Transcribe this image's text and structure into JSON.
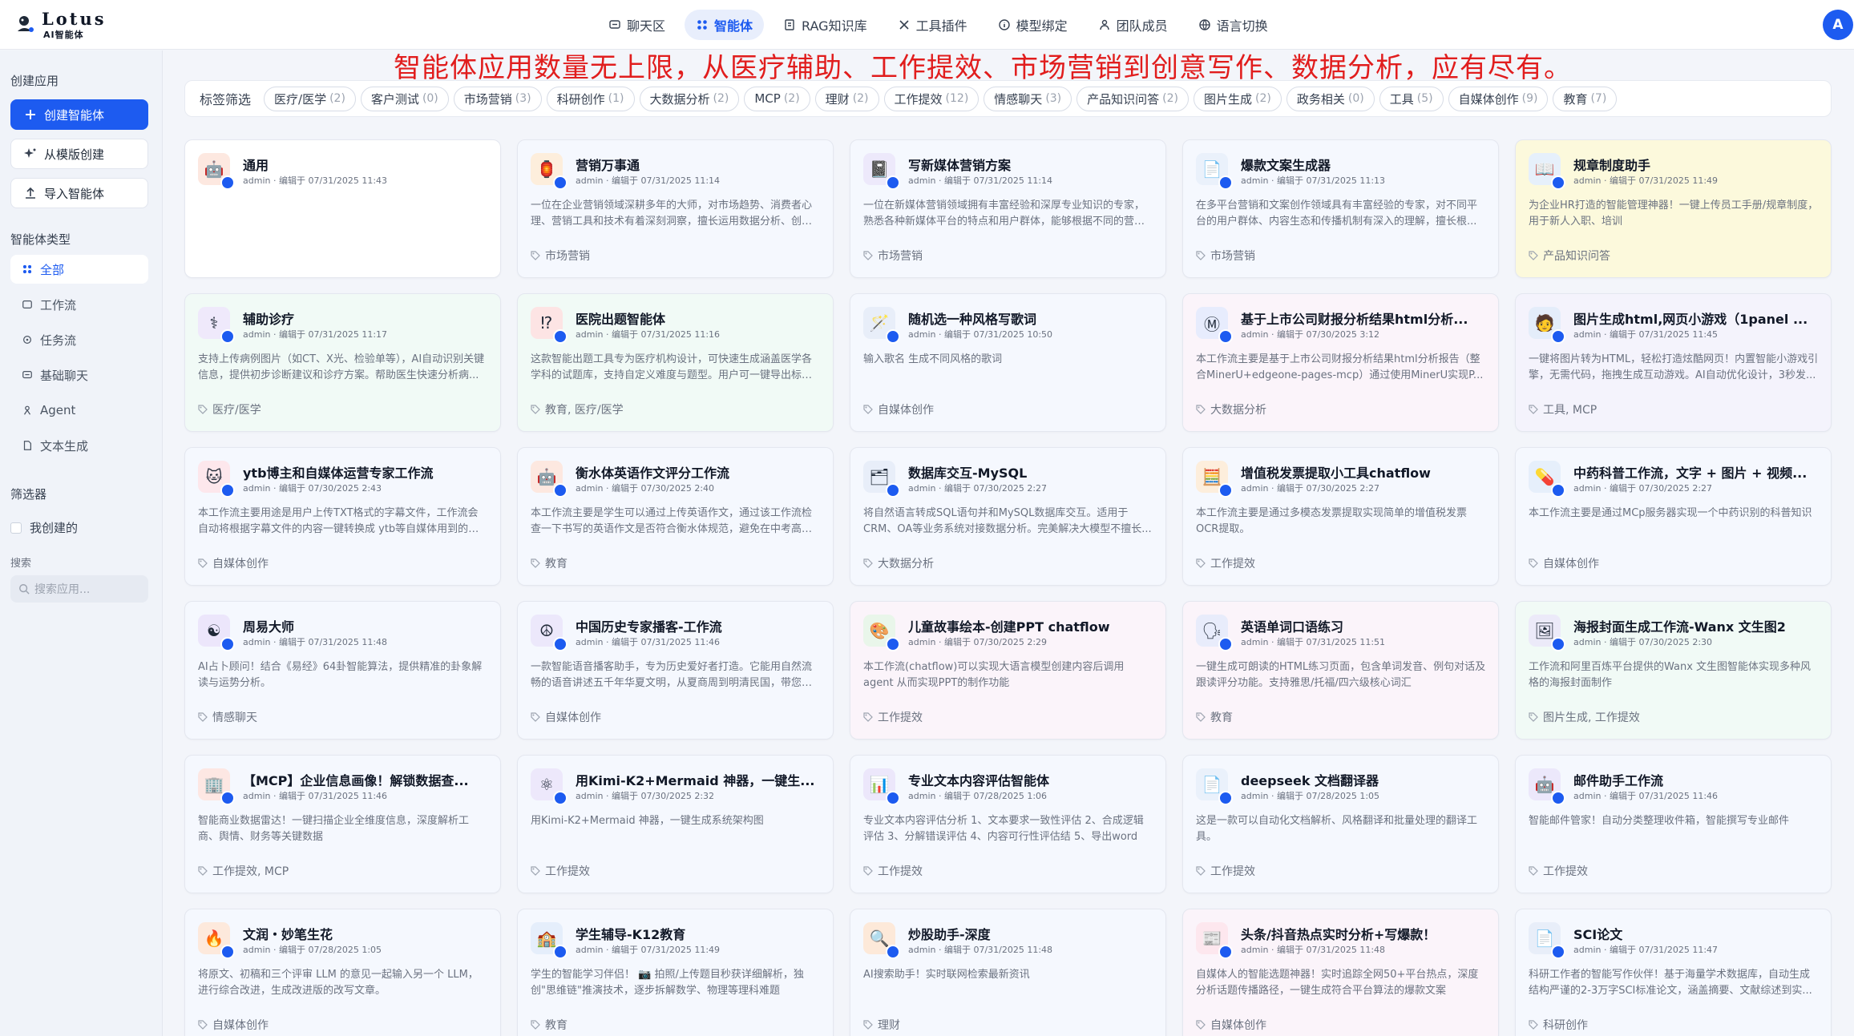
{
  "brand": {
    "name": "Lotus",
    "subtitle": "AI智能体"
  },
  "nav": [
    {
      "label": "聊天区",
      "icon": "chat-icon"
    },
    {
      "label": "智能体",
      "icon": "grid-icon",
      "active": true
    },
    {
      "label": "RAG知识库",
      "icon": "book-icon"
    },
    {
      "label": "工具插件",
      "icon": "tool-icon"
    },
    {
      "label": "模型绑定",
      "icon": "info-icon"
    },
    {
      "label": "团队成员",
      "icon": "team-icon"
    },
    {
      "label": "语言切换",
      "icon": "globe-icon"
    }
  ],
  "user": {
    "initial": "A"
  },
  "banner": "智能体应用数量无上限，从医疗辅助、工作提效、市场营销到创意写作、数据分析，应有尽有。",
  "sidebar": {
    "create_heading": "创建应用",
    "create_buttons": [
      {
        "label": "创建智能体",
        "icon": "plus-icon"
      },
      {
        "label": "从模版创建",
        "icon": "sparkle-icon"
      },
      {
        "label": "导入智能体",
        "icon": "upload-icon"
      }
    ],
    "type_heading": "智能体类型",
    "types": [
      {
        "label": "全部",
        "icon": "grid-icon",
        "active": true
      },
      {
        "label": "工作流",
        "icon": "workflow-icon"
      },
      {
        "label": "任务流",
        "icon": "taskflow-icon"
      },
      {
        "label": "基础聊天",
        "icon": "chat-icon"
      },
      {
        "label": "Agent",
        "icon": "agent-icon"
      },
      {
        "label": "文本生成",
        "icon": "doc-icon"
      }
    ],
    "filter_heading": "筛选器",
    "mine_label": "我创建的",
    "search_label": "搜索",
    "search_placeholder": "搜索应用..."
  },
  "filter": {
    "label": "标签筛选",
    "chips": [
      {
        "name": "医疗/医学",
        "count": "(2)"
      },
      {
        "name": "客户测试",
        "count": "(0)"
      },
      {
        "name": "市场营销",
        "count": "(3)"
      },
      {
        "name": "科研创作",
        "count": "(1)"
      },
      {
        "name": "大数据分析",
        "count": "(2)"
      },
      {
        "name": "MCP",
        "count": "(2)"
      },
      {
        "name": "理财",
        "count": "(2)"
      },
      {
        "name": "工作提效",
        "count": "(12)"
      },
      {
        "name": "情感聊天",
        "count": "(3)"
      },
      {
        "name": "产品知识问答",
        "count": "(2)"
      },
      {
        "name": "图片生成",
        "count": "(2)"
      },
      {
        "name": "政务相关",
        "count": "(0)"
      },
      {
        "name": "工具",
        "count": "(5)"
      },
      {
        "name": "自媒体创作",
        "count": "(9)"
      },
      {
        "name": "教育",
        "count": "(7)"
      }
    ]
  },
  "cards": [
    {
      "title": "通用",
      "meta": "admin · 编辑于 07/31/2025 11:43",
      "desc": "",
      "tags": "",
      "bg": "white",
      "icon": "robot-icon",
      "icon_bg": "#fde8e0",
      "glyph": "🤖"
    },
    {
      "title": "营销万事通",
      "meta": "admin · 编辑于 07/31/2025 11:14",
      "desc": "一位在企业营销领域深耕多年的大师，对市场趋势、消费者心理、营销工具和技术有着深刻洞察，擅长运用数据分析、创意策划等手段...",
      "tags": "市场营销",
      "bg": "default",
      "icon": "lantern-icon",
      "icon_bg": "#fdeedc",
      "glyph": "🏮"
    },
    {
      "title": "写新媒体营销方案",
      "meta": "admin · 编辑于 07/31/2025 11:14",
      "desc": "一位在新媒体营销领域拥有丰富经验和深厚专业知识的专家，熟悉各种新媒体平台的特点和用户群体，能够根据不同的营销...",
      "tags": "市场营销",
      "bg": "default",
      "icon": "notebook-icon",
      "icon_bg": "#ede9fb",
      "glyph": "📓"
    },
    {
      "title": "爆款文案生成器",
      "meta": "admin · 编辑于 07/31/2025 11:13",
      "desc": "在多平台营销和文案创作领域具有丰富经验的专家，对不同平台的用户群体、内容生态和传播机制有深入的理解，擅长根...",
      "tags": "市场营销",
      "bg": "default",
      "icon": "document-icon",
      "icon_bg": "#eaf1fb",
      "glyph": "📄"
    },
    {
      "title": "规章制度助手",
      "meta": "admin · 编辑于 07/31/2025 11:49",
      "desc": "为企业HR打造的智能管理神器！一键上传员工手册/规章制度，用于新人入职、培训",
      "tags": "产品知识问答",
      "bg": "yellow",
      "icon": "book-icon",
      "icon_bg": "#e6f0fb",
      "glyph": "📖"
    },
    {
      "title": "辅助诊疗",
      "meta": "admin · 编辑于 07/31/2025 11:17",
      "desc": "支持上传病例图片（如CT、X光、检验单等），AI自动识别关键信息，提供初步诊断建议和诊疗方案。帮助医生快速分析病...",
      "tags": "医疗/医学",
      "bg": "green",
      "icon": "medical-icon",
      "icon_bg": "#efe9fb",
      "glyph": "⚕"
    },
    {
      "title": "医院出题智能体",
      "meta": "admin · 编辑于 07/31/2025 11:16",
      "desc": "这款智能出题工具专为医疗机构设计，可快速生成涵盖医学各学科的试题库，支持自定义难度与题型。用户可一键导出标准...",
      "tags": "教育, 医疗/医学",
      "bg": "green",
      "icon": "question-icon",
      "icon_bg": "#fde4e4",
      "glyph": "⁉"
    },
    {
      "title": "随机选一种风格写歌词",
      "meta": "admin · 编辑于 07/31/2025 10:50",
      "desc": "输入歌名 生成不同风格的歌词",
      "tags": "自媒体创作",
      "bg": "default",
      "icon": "magic-wand-icon",
      "icon_bg": "#e8eef9",
      "glyph": "🪄"
    },
    {
      "title": "基于上市公司财报分析结果html分析...",
      "meta": "admin · 编辑于 07/30/2025 3:12",
      "desc": "本工作流主要是基于上市公司财报分析结果html分析报告（整合MinerU+edgeone-pages-mcp）通过使用MinerU实现P...",
      "tags": "大数据分析",
      "bg": "pink",
      "icon": "m-icon",
      "icon_bg": "#e7ecfd",
      "glyph": "Ⓜ"
    },
    {
      "title": "图片生成html,网页小游戏（1panel ...",
      "meta": "admin · 编辑于 07/31/2025 11:45",
      "desc": "一键将图片转为HTML，轻松打造炫酷网页！内置智能小游戏引擎，无需代码，拖拽生成互动游戏。AI自动优化设计，3秒发...",
      "tags": "工具, MCP",
      "bg": "lav",
      "icon": "person-icon",
      "icon_bg": "#e4edfa",
      "glyph": "🧑"
    },
    {
      "title": "ytb博主和自媒体运营专家工作流",
      "meta": "admin · 编辑于 07/30/2025 2:43",
      "desc": "本工作流主要用途是用户上传TXT格式的字幕文件，工作流会自动将根据字幕文件的内容一键转换成 ytb等自媒体用到的标题...",
      "tags": "自媒体创作",
      "bg": "default",
      "icon": "cartoon-icon",
      "icon_bg": "#fde7ec",
      "glyph": "🐱"
    },
    {
      "title": "衡水体英语作文评分工作流",
      "meta": "admin · 编辑于 07/30/2025 2:40",
      "desc": "本工作流主要是学生可以通过上传英语作文，通过该工作流检查一下书写的英语作文是否符合衡水体规范，避免在中考高考...",
      "tags": "教育",
      "bg": "default",
      "icon": "robot-icon",
      "icon_bg": "#fde8e0",
      "glyph": "🤖"
    },
    {
      "title": "数据库交互-MySQL",
      "meta": "admin · 编辑于 07/30/2025 2:27",
      "desc": "将自然语言转成SQL语句并和MySQL数据库交互。适用于CRM、OA等业务系统对接数据分析。完美解决大模型不擅长...",
      "tags": "大数据分析",
      "bg": "default",
      "icon": "database-icon",
      "icon_bg": "#e8eef9",
      "glyph": "🗂"
    },
    {
      "title": "增值税发票提取小工具chatflow",
      "meta": "admin · 编辑于 07/30/2025 2:27",
      "desc": "本工作流主要是通过多模态发票提取实现简单的增值税发票OCR提取。",
      "tags": "工作提效",
      "bg": "default",
      "icon": "calculator-icon",
      "icon_bg": "#fdeedc",
      "glyph": "🧮"
    },
    {
      "title": "中药科普工作流，文字 + 图片 + 视频...",
      "meta": "admin · 编辑于 07/30/2025 2:27",
      "desc": "本工作流主要是通过MCp服务器实现一个中药识别的科普知识",
      "tags": "自媒体创作",
      "bg": "default",
      "icon": "pill-icon",
      "icon_bg": "#e6effb",
      "glyph": "💊"
    },
    {
      "title": "周易大师",
      "meta": "admin · 编辑于 07/31/2025 11:48",
      "desc": "AI占卜顾问！结合《易经》64卦智能算法，提供精准的卦象解读与运势分析。",
      "tags": "情感聊天",
      "bg": "default",
      "icon": "yin-yang-icon",
      "icon_bg": "#ece6fb",
      "glyph": "☯"
    },
    {
      "title": "中国历史专家播客-工作流",
      "meta": "admin · 编辑于 07/31/2025 11:46",
      "desc": "一款智能语音播客助手，专为历史爱好者打造。它能用自然流畅的语音讲述五千年华夏文明，从夏商周到明清民国，带您穿...",
      "tags": "自媒体创作",
      "bg": "default",
      "icon": "peace-icon",
      "icon_bg": "#ece8fb",
      "glyph": "☮"
    },
    {
      "title": "儿童故事绘本-创建PPT chatflow",
      "meta": "admin · 编辑于 07/30/2025 2:29",
      "desc": "本工作流(chatflow)可以实现大语言模型创建内容后调用agent 从而实现PPT的制作功能",
      "tags": "工作提效",
      "bg": "pink",
      "icon": "picture-book-icon",
      "icon_bg": "#e9f6ea",
      "glyph": "🎨"
    },
    {
      "title": "英语单词口语练习",
      "meta": "admin · 编辑于 07/31/2025 11:51",
      "desc": "一键生成可朗读的HTML练习页面，包含单词发音、例句对话及跟读评分功能。支持雅思/托福/四六级核心词汇",
      "tags": "教育",
      "bg": "pink",
      "icon": "speaking-icon",
      "icon_bg": "#e8ecfb",
      "glyph": "🗣"
    },
    {
      "title": "海报封面生成工作流-Wanx 文生图2",
      "meta": "admin · 编辑于 07/30/2025 2:30",
      "desc": "工作流和阿里百炼平台提供的Wanx 文生图智能体实现多种风格的海报封面制作",
      "tags": "图片生成, 工作提效",
      "bg": "green",
      "icon": "poster-icon",
      "icon_bg": "#eceaf9",
      "glyph": "🖼"
    },
    {
      "title": "【MCP】企业信息画像！解锁数据查...",
      "meta": "admin · 编辑于 07/31/2025 11:46",
      "desc": "智能商业数据雷达！一键扫描企业全维度信息，深度解析工商、舆情、财务等关键数据",
      "tags": "工作提效, MCP",
      "bg": "default",
      "icon": "building-icon",
      "icon_bg": "#fde7e3",
      "glyph": "🏢"
    },
    {
      "title": "用Kimi-K2+Mermaid 神器，一键生...",
      "meta": "admin · 编辑于 07/30/2025 2:32",
      "desc": "用Kimi-K2+Mermaid 神器，一键生成系统架构图",
      "tags": "工作提效",
      "bg": "default",
      "icon": "atom-icon",
      "icon_bg": "#ede8fb",
      "glyph": "⚛"
    },
    {
      "title": "专业文本内容评估智能体",
      "meta": "admin · 编辑于 07/28/2025 1:06",
      "desc": "专业文本内容评估分析 1、文本要求一致性评估 2、合成逻辑评估 3、分解错误评估 4、内容可行性评估结 5、导出word",
      "tags": "工作提效",
      "bg": "default",
      "icon": "report-icon",
      "icon_bg": "#ece7fb",
      "glyph": "📊"
    },
    {
      "title": "deepseek 文档翻译器",
      "meta": "admin · 编辑于 07/28/2025 1:05",
      "desc": "这是一款可以自动化文档解析、风格翻译和批量处理的翻译工具。",
      "tags": "工作提效",
      "bg": "default",
      "icon": "document-icon",
      "icon_bg": "#eaf1fb",
      "glyph": "📄"
    },
    {
      "title": "邮件助手工作流",
      "meta": "admin · 编辑于 07/31/2025 11:46",
      "desc": "智能邮件管家！自动分类整理收件箱，智能撰写专业邮件",
      "tags": "工作提效",
      "bg": "default",
      "icon": "mail-robot-icon",
      "icon_bg": "#ece8fb",
      "glyph": "🤖"
    },
    {
      "title": "文润・妙笔生花",
      "meta": "admin · 编辑于 07/28/2025 1:05",
      "desc": "将原文、初稿和三个评审 LLM 的意见一起输入另一个 LLM，进行综合改进，生成改进版的改写文章。",
      "tags": "自媒体创作",
      "bg": "default",
      "icon": "fire-icon",
      "icon_bg": "#fde9dc",
      "glyph": "🔥"
    },
    {
      "title": "学生辅导-K12教育",
      "meta": "admin · 编辑于 07/31/2025 11:49",
      "desc": "学生的智能学习伴侣！ 📷 拍照/上传题目秒获详细解析，独创\"思维链\"推演技术，逐步拆解数学、物理等理科难题",
      "tags": "教育",
      "bg": "default",
      "icon": "school-icon",
      "icon_bg": "#e5eefb",
      "glyph": "🏫"
    },
    {
      "title": "炒股助手-深度",
      "meta": "admin · 编辑于 07/31/2025 11:48",
      "desc": "AI搜索助手！实时联网检索最新资讯",
      "tags": "理财",
      "bg": "default",
      "icon": "magnifier-icon",
      "icon_bg": "#fde9d9",
      "glyph": "🔍"
    },
    {
      "title": "头条/抖音热点实时分析+写爆款！",
      "meta": "admin · 编辑于 07/31/2025 11:48",
      "desc": "自媒体人的智能选题神器！实时追踪全网50+平台热点，深度分析话题传播路径，一键生成符合平台算法的爆款文案",
      "tags": "自媒体创作",
      "bg": "pink",
      "icon": "newspaper-icon",
      "icon_bg": "#fde7ee",
      "glyph": "📰"
    },
    {
      "title": "SCI论文",
      "meta": "admin · 编辑于 07/31/2025 11:47",
      "desc": "科研工作者的智能写作伙伴！基于海量学术数据库，自动生成结构严谨的2-3万字SCI标准论文，涵盖摘要、文献综述到实...",
      "tags": "科研创作",
      "bg": "default",
      "icon": "document-icon",
      "icon_bg": "#e8eef9",
      "glyph": "📄"
    }
  ]
}
